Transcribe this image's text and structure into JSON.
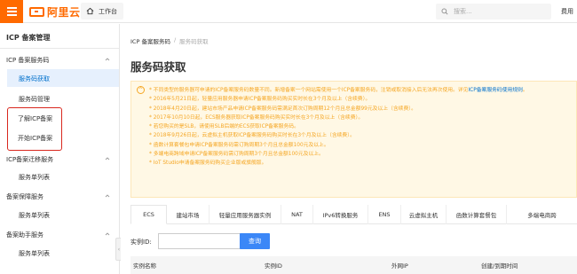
{
  "topbar": {
    "brand": "阿里云",
    "workbench_label": "工作台",
    "search_placeholder": "搜索...",
    "fee_label": "费用"
  },
  "sidebar": {
    "title": "ICP 备案管理",
    "groups": [
      {
        "label": "ICP 备案服务码",
        "items": [
          "服务码获取",
          "服务码管理"
        ]
      },
      {
        "label": "ICP备案迁移服务",
        "items": [
          "服务单列表"
        ]
      },
      {
        "label": "备案保障服务",
        "items": [
          "服务单列表"
        ]
      },
      {
        "label": "备案助手服务",
        "items": [
          "服务单列表"
        ]
      }
    ],
    "highlighted_items": [
      "了解ICP备案",
      "开始ICP备案"
    ],
    "active_item": "服务码获取"
  },
  "main": {
    "breadcrumb": [
      "ICP 备案服务码",
      "/",
      "服务码获取"
    ],
    "title": "服务码获取",
    "notice": {
      "lines": [
        {
          "text": "* 不同类型的服务器可申请的ICP备案服务码数量不同。新增备案一个网站需使用一个ICP备案服务码，注销或取消接入后无法再次使用。详见",
          "link": "ICP备案服务码使用规则",
          "tail": "。"
        },
        {
          "text": "* 2016年5月21日起，轻量应用服务器申请ICP备案服务码购买实时长在3个月及以上（含续费）。"
        },
        {
          "text": "* 2018年4月20日起，建站市场产品申请ICP备案服务码需满足首次订购周期12个月且总金额99元及以上（含续费）。"
        },
        {
          "text": "* 2017年10月10日起，ECS服务器获取ICP备案服务码购买实时长在3个月及以上（含续费）。"
        },
        {
          "text": "* 若您购买的是SLB，请使用SLB后端的ECS获取ICP备案服务码。"
        },
        {
          "text": "* 2018年9月26日起，云虚拟主机获取ICP备案服务码购买时长在3个月及以上（含续费）。"
        },
        {
          "text": "* 函数计算套餐包申请ICP备案服务码需订购周期3个月且总金额100元及以上。"
        },
        {
          "text": "* 多端电商跨域申请ICP备案服务码需订购周期3个月且总金额100元及以上。"
        },
        {
          "text": "* IoT Studio申请备案服务码购买企业版或旗舰版。"
        }
      ]
    },
    "tabs": [
      "ECS",
      "建站市场",
      "轻量应用服务器实例",
      "NAT",
      "IPv6转换服务",
      "ENS",
      "云虚拟主机",
      "函数计算套餐包",
      "多端电商跨"
    ],
    "active_tab": "ECS",
    "filter": {
      "label": "实例ID:",
      "value": "",
      "query_label": "查询"
    },
    "table_headers": [
      "实例名称",
      "实例ID",
      "外网IP",
      "创建/到期时间"
    ]
  },
  "colors": {
    "brand": "#ff6a00",
    "link": "#0070cc",
    "notice_text": "#f5a623",
    "primary_button": "#3b87f7",
    "highlight_box": "#d9271e"
  }
}
